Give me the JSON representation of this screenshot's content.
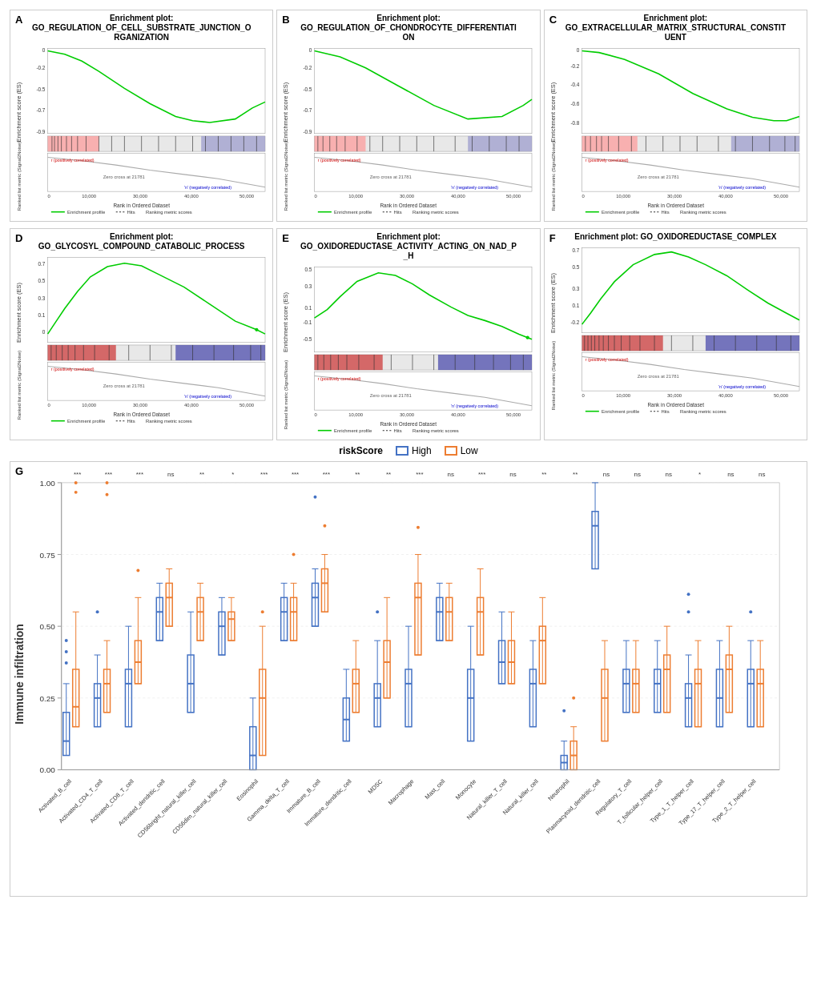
{
  "panels": {
    "row1": [
      {
        "label": "A",
        "title": "Enrichment plot:\nGO_REGULATION_OF_CELL_SUBSTRATE_JUNCTION_O\nRGANIZATION",
        "direction": "negative",
        "zeroCross": "21781",
        "esRange": [
          0,
          -0.8
        ]
      },
      {
        "label": "B",
        "title": "Enrichment plot:\nGO_REGULATION_OF_CHONDROCYTE_DIFFERENTIATI\nON",
        "direction": "negative",
        "zeroCross": "21781",
        "esRange": [
          0,
          -0.8
        ]
      },
      {
        "label": "C",
        "title": "Enrichment plot:\nGO_EXTRACELLULAR_MATRIX_STRUCTURAL_CONSTIT\nUENT",
        "direction": "negative",
        "zeroCross": "21781",
        "esRange": [
          0,
          -0.8
        ]
      }
    ],
    "row2": [
      {
        "label": "D",
        "title": "Enrichment plot:\nGO_GLYCOSYL_COMPOUND_CATABOLIC_PROCESS",
        "direction": "positive",
        "zeroCross": "21781",
        "esRange": [
          0.7,
          0
        ]
      },
      {
        "label": "E",
        "title": "Enrichment plot:\nGO_OXIDOREDUCTASE_ACTIVITY_ACTING_ON_NAD_P\n_H",
        "direction": "positive",
        "zeroCross": "21781",
        "esRange": [
          0.5,
          0
        ]
      },
      {
        "label": "F",
        "title": "Enrichment plot: GO_OXIDOREDUCTASE_COMPLEX",
        "direction": "positive",
        "zeroCross": "21781",
        "esRange": [
          0.7,
          0
        ]
      }
    ]
  },
  "legend": {
    "title": "riskScore",
    "items": [
      {
        "label": "High",
        "color": "#4472C4",
        "borderColor": "#4472C4"
      },
      {
        "label": "Low",
        "color": "#ED7D31",
        "borderColor": "#ED7D31"
      }
    ]
  },
  "panelG": {
    "label": "G",
    "yAxisLabel": "Immune infiltration",
    "xLabels": [
      "Activated_B_cell",
      "Activated_CD4_T_cell",
      "Activated_CD8_T_cell",
      "Activated_dendritic_cell",
      "CD56bright_natural_killer_cell",
      "CD56dim_natural_killer_cell",
      "Eosinophil",
      "Gamma_delta_T_cell",
      "Immature_B_cell",
      "Immature_dendritic_cell",
      "MDSC",
      "Macrophage",
      "Mast_cell",
      "Monocyte",
      "Natural_killer_T_cell",
      "Natural_killer_cell",
      "Neutrophil",
      "Plasmacytoid_dendritic_cell",
      "Regulatory_T_cell",
      "T_follicular_helper_cell",
      "Type_1_T_helper_cell",
      "Type_17_T_helper_cell",
      "Type_2_T_helper_cell"
    ],
    "significance": [
      "***",
      "***",
      "***",
      "ns",
      "**",
      "*",
      "***",
      "***",
      "***",
      "**",
      "**",
      "***",
      "ns",
      "***",
      "ns",
      "**",
      "**",
      "ns",
      "ns",
      "ns",
      "*",
      "ns",
      "ns"
    ]
  }
}
